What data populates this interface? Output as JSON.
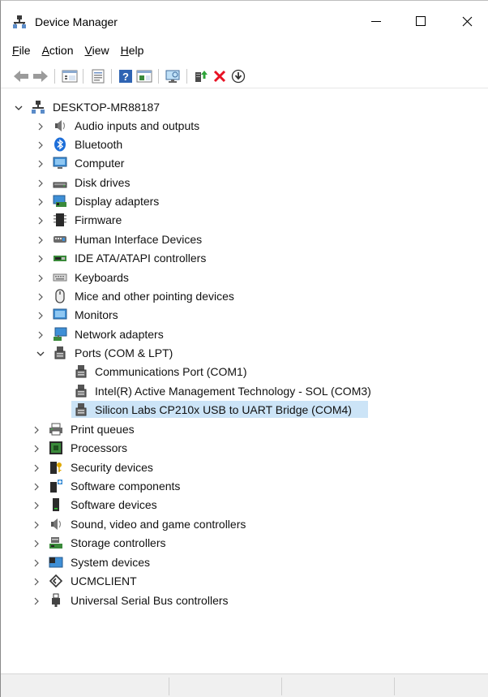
{
  "window": {
    "title": "Device Manager"
  },
  "menu": [
    {
      "label": "File",
      "mnemonic": "F",
      "rest": "ile"
    },
    {
      "label": "Action",
      "mnemonic": "A",
      "rest": "ction"
    },
    {
      "label": "View",
      "mnemonic": "V",
      "rest": "iew"
    },
    {
      "label": "Help",
      "mnemonic": "H",
      "rest": "elp"
    }
  ],
  "toolbar": [
    "back-arrow-icon",
    "forward-arrow-icon",
    "show-hide-tree-icon",
    "properties-icon",
    "help-icon",
    "properties-pane-icon",
    "scan-hardware-icon",
    "update-driver-icon",
    "uninstall-icon",
    "download-icon"
  ],
  "tree": {
    "root": "DESKTOP-MR88187",
    "categories": [
      {
        "label": "Audio inputs and outputs",
        "icon": "speaker-icon"
      },
      {
        "label": "Bluetooth",
        "icon": "bluetooth-icon"
      },
      {
        "label": "Computer",
        "icon": "computer-icon"
      },
      {
        "label": "Disk drives",
        "icon": "disk-drive-icon"
      },
      {
        "label": "Display adapters",
        "icon": "display-adapter-icon"
      },
      {
        "label": "Firmware",
        "icon": "firmware-icon"
      },
      {
        "label": "Human Interface Devices",
        "icon": "hid-icon"
      },
      {
        "label": "IDE ATA/ATAPI controllers",
        "icon": "ide-controller-icon"
      },
      {
        "label": "Keyboards",
        "icon": "keyboard-icon"
      },
      {
        "label": "Mice and other pointing devices",
        "icon": "mouse-icon"
      },
      {
        "label": "Monitors",
        "icon": "monitor-icon"
      },
      {
        "label": "Network adapters",
        "icon": "network-adapter-icon"
      },
      {
        "label": "Ports (COM & LPT)",
        "icon": "port-icon",
        "expanded": true,
        "children": [
          {
            "label": "Communications Port (COM1)"
          },
          {
            "label": "Intel(R) Active Management Technology - SOL (COM3)"
          },
          {
            "label": "Silicon Labs CP210x USB to UART Bridge (COM4)",
            "selected": true
          }
        ]
      },
      {
        "label": "Print queues",
        "icon": "printer-icon"
      },
      {
        "label": "Processors",
        "icon": "processor-icon"
      },
      {
        "label": "Security devices",
        "icon": "security-device-icon"
      },
      {
        "label": "Software components",
        "icon": "software-component-icon"
      },
      {
        "label": "Software devices",
        "icon": "software-device-icon"
      },
      {
        "label": "Sound, video and game controllers",
        "icon": "sound-controller-icon"
      },
      {
        "label": "Storage controllers",
        "icon": "storage-controller-icon"
      },
      {
        "label": "System devices",
        "icon": "system-devices-icon"
      },
      {
        "label": "UCMCLIENT",
        "icon": "ucmclient-icon"
      },
      {
        "label": "Universal Serial Bus controllers",
        "icon": "usb-icon"
      }
    ]
  },
  "colors": {
    "selection": "#cce4f7",
    "status_bar": "#f0f0f0",
    "bluetooth": "#1e6fd9",
    "delete_red": "#e81123"
  }
}
